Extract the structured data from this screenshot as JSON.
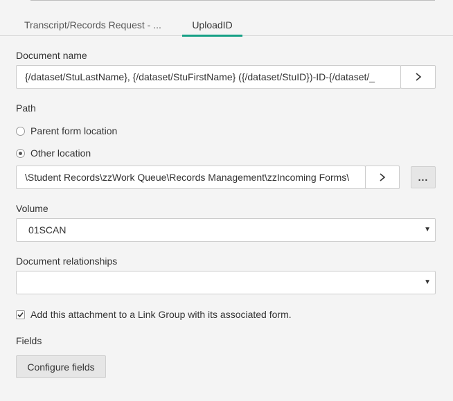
{
  "tabs": [
    {
      "label": "Transcript/Records Request - ..."
    },
    {
      "label": "UploadID"
    }
  ],
  "document_name": {
    "label": "Document name",
    "value": "{/dataset/StuLastName}, {/dataset/StuFirstName} ({/dataset/StuID})-ID-{/dataset/_"
  },
  "path": {
    "label": "Path",
    "options": [
      {
        "label": "Parent form location",
        "selected": false
      },
      {
        "label": "Other location",
        "selected": true
      }
    ],
    "value": "\\Student Records\\zzWork Queue\\Records Management\\zzIncoming Forms\\",
    "browse_label": "..."
  },
  "volume": {
    "label": "Volume",
    "selected": "01SCAN"
  },
  "relationships": {
    "label": "Document relationships",
    "selected": ""
  },
  "link_group": {
    "label": "Add this attachment to a Link Group with its associated form.",
    "checked": true
  },
  "fields": {
    "label": "Fields",
    "button_label": "Configure fields"
  },
  "icons": {
    "chevron_right": "chevron-right-icon",
    "caret_down": "caret-down-icon",
    "check": "check-icon"
  },
  "colors": {
    "accent": "#16a085",
    "background": "#f4f4f4",
    "border": "#cccccc"
  }
}
